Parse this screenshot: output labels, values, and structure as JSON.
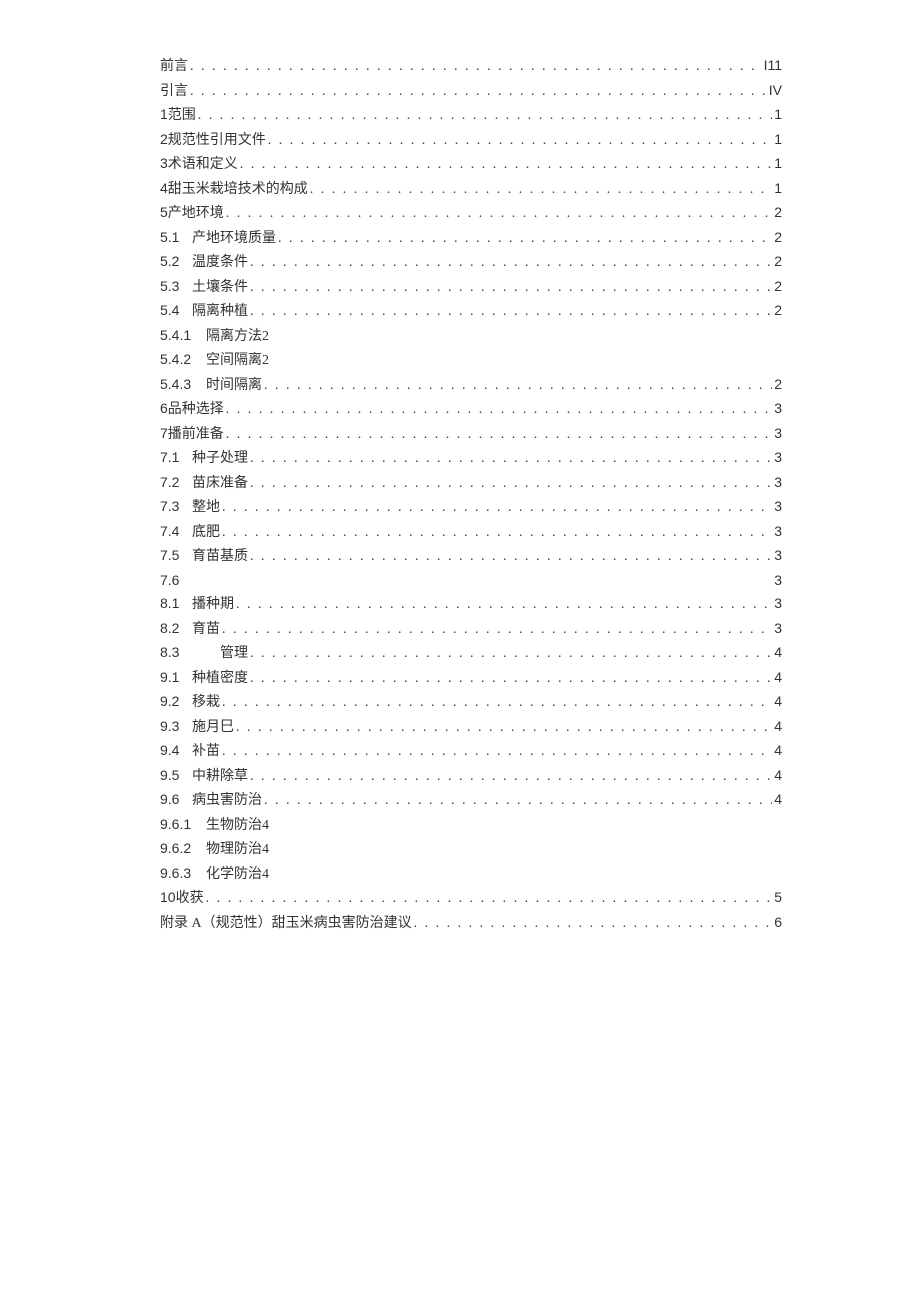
{
  "toc": [
    {
      "prefix": "",
      "title": "前言",
      "page": "I11",
      "dots": true,
      "level": 0
    },
    {
      "prefix": "",
      "title": "引言 ",
      "page": "IV",
      "dots": true,
      "level": 0
    },
    {
      "prefix": "1 ",
      "title": "范围",
      "page": "1",
      "dots": true,
      "level": 0
    },
    {
      "prefix": "2 ",
      "title": "规范性引用文件",
      "page": "1",
      "dots": true,
      "level": 0
    },
    {
      "prefix": "3 ",
      "title": "术语和定义",
      "page": "1",
      "dots": true,
      "level": 0
    },
    {
      "prefix": "4 ",
      "title": "甜玉米栽培技术的构成",
      "page": "1",
      "dots": true,
      "level": 0
    },
    {
      "prefix": "5 ",
      "title": "产地环境",
      "page": "2",
      "dots": true,
      "level": 0
    },
    {
      "prefix": "5.1",
      "title": "产地环境质量",
      "page": "2",
      "dots": true,
      "level": 1
    },
    {
      "prefix": "5.2",
      "title": "温度条件",
      "page": "2",
      "dots": true,
      "level": 1
    },
    {
      "prefix": "5.3",
      "title": "土壤条件",
      "page": "2",
      "dots": true,
      "level": 1
    },
    {
      "prefix": "5.4",
      "title": "隔离种植",
      "page": "2",
      "dots": true,
      "level": 1
    },
    {
      "prefix": "5.4.1",
      "title": "隔离方法",
      "page": "2",
      "dots": false,
      "level": 2,
      "inlinePage": true
    },
    {
      "prefix": "5.4.2",
      "title": "空间隔离",
      "page": "2",
      "dots": false,
      "level": 2,
      "inlinePage": true
    },
    {
      "prefix": "5.4.3",
      "title": "时间隔离 ",
      "page": "2",
      "dots": true,
      "level": 2
    },
    {
      "prefix": "6 ",
      "title": "品种选择",
      "page": "3",
      "dots": true,
      "level": 0
    },
    {
      "prefix": "7 ",
      "title": "播前准备",
      "page": "3",
      "dots": true,
      "level": 0
    },
    {
      "prefix": "7.1",
      "title": "种子处理",
      "page": "3",
      "dots": true,
      "level": 1
    },
    {
      "prefix": "7.2",
      "title": "苗床准备",
      "page": "3",
      "dots": true,
      "level": 1
    },
    {
      "prefix": "7.3",
      "title": "整地",
      "page": "3",
      "dots": true,
      "level": 1
    },
    {
      "prefix": "7.4",
      "title": "底肥",
      "page": "3",
      "dots": true,
      "level": 1
    },
    {
      "prefix": "7.5",
      "title": "育苗基质",
      "page": "3",
      "dots": true,
      "level": 1
    },
    {
      "prefix": "7.6",
      "title": "",
      "page": "3",
      "dots": false,
      "level": 1,
      "special76": true
    },
    {
      "prefix": "8.1",
      "title": "播种期",
      "page": "3",
      "dots": true,
      "level": 1
    },
    {
      "prefix": "8.2",
      "title": "育苗",
      "page": "3",
      "dots": true,
      "level": 1
    },
    {
      "prefix": "8.3",
      "title": "　　管理",
      "page": "4",
      "dots": true,
      "level": 1
    },
    {
      "prefix": "9.1",
      "title": "种植密度",
      "page": "4",
      "dots": true,
      "level": 1
    },
    {
      "prefix": "9.2",
      "title": "移栽",
      "page": "4",
      "dots": true,
      "level": 1
    },
    {
      "prefix": "9.3",
      "title": "施月巳",
      "page": "4",
      "dots": true,
      "level": 1
    },
    {
      "prefix": "9.4",
      "title": "补苗",
      "page": "4",
      "dots": true,
      "level": 1
    },
    {
      "prefix": "9.5",
      "title": "中耕除草",
      "page": "4",
      "dots": true,
      "level": 1
    },
    {
      "prefix": "9.6",
      "title": "病虫害防治",
      "page": "4",
      "dots": true,
      "level": 1
    },
    {
      "prefix": "9.6.1",
      "title": "生物防治",
      "page": "4",
      "dots": false,
      "level": 2,
      "inlinePage": true
    },
    {
      "prefix": "9.6.2",
      "title": "物理防治",
      "page": "4",
      "dots": false,
      "level": 2,
      "inlinePage": true
    },
    {
      "prefix": "9.6.3",
      "title": "化学防治",
      "page": "4",
      "dots": false,
      "level": 2,
      "inlinePage": true
    },
    {
      "prefix": "10 ",
      "title": "收获",
      "page": "5",
      "dots": true,
      "level": 0
    },
    {
      "prefix": "",
      "title": "附录 A（规范性）甜玉米病虫害防治建议 ",
      "page": "6",
      "dots": true,
      "level": 0
    }
  ]
}
